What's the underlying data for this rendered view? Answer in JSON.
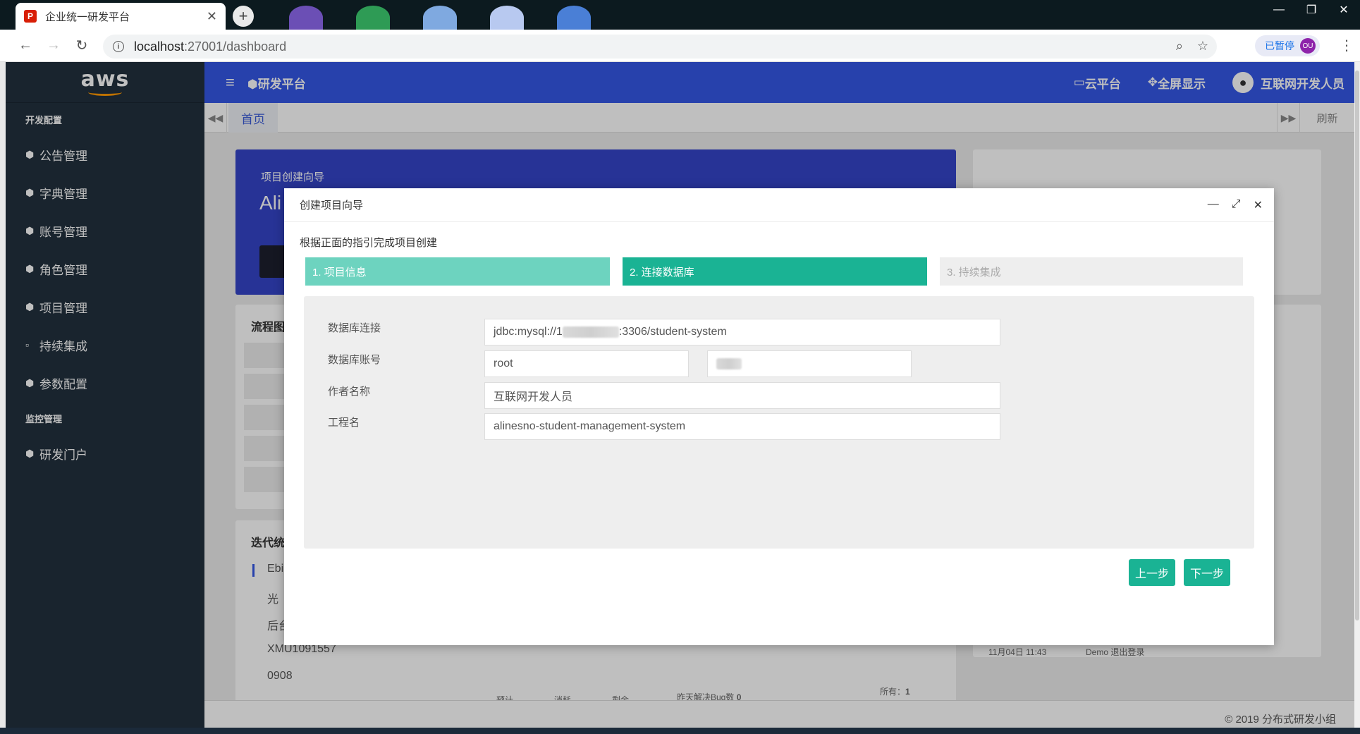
{
  "browser": {
    "tab_title": "企业统一研发平台",
    "tab_favicon": "P",
    "url_host": "localhost",
    "url_path": ":27001/dashboard",
    "paused_label": "已暂停",
    "profile_initials": "OU"
  },
  "sidebar": {
    "logo": "aws",
    "sections": [
      {
        "label": "开发配置",
        "items": [
          "公告管理",
          "字典管理",
          "账号管理",
          "角色管理",
          "项目管理",
          "持续集成",
          "参数配置"
        ]
      },
      {
        "label": "监控管理",
        "items": [
          "研发门户"
        ]
      }
    ]
  },
  "topnav": {
    "title": "研发平台",
    "cloud": "云平台",
    "fullscreen": "全屏显示",
    "user": "互联网开发人员"
  },
  "tabstrip": {
    "home": "首页",
    "refresh": "刷新"
  },
  "dashboard": {
    "wizard_sub": "项目创建向导",
    "wizard_big": "Ali",
    "flow_title": "流程图",
    "iter_title": "迭代统",
    "iter_items": [
      "Ebi",
      "光",
      "后台",
      "XMU1091557",
      "0908"
    ],
    "legend": [
      "预计",
      "消耗",
      "剩余"
    ],
    "bug_label": "昨天解决Bug数",
    "bug_count": "0",
    "all_label": "所有：",
    "all_count": "1",
    "log_time": "11月04日 11:43",
    "log_text": "Demo 退出登录"
  },
  "modal": {
    "title": "创建项目向导",
    "desc": "根据正面的指引完成项目创建",
    "steps": [
      "1. 项目信息",
      "2. 连接数据库",
      "3. 持续集成"
    ],
    "fields": {
      "db_conn_label": "数据库连接",
      "db_conn_prefix": "jdbc:mysql://1",
      "db_conn_suffix": ":3306/student-system",
      "db_account_label": "数据库账号",
      "db_user": "root",
      "author_label": "作者名称",
      "author": "互联网开发人员",
      "project_label": "工程名",
      "project": "alinesno-student-management-system"
    },
    "prev_btn": "上一步",
    "next_btn": "下一步"
  },
  "footer": "© 2019 分布式研发小组"
}
